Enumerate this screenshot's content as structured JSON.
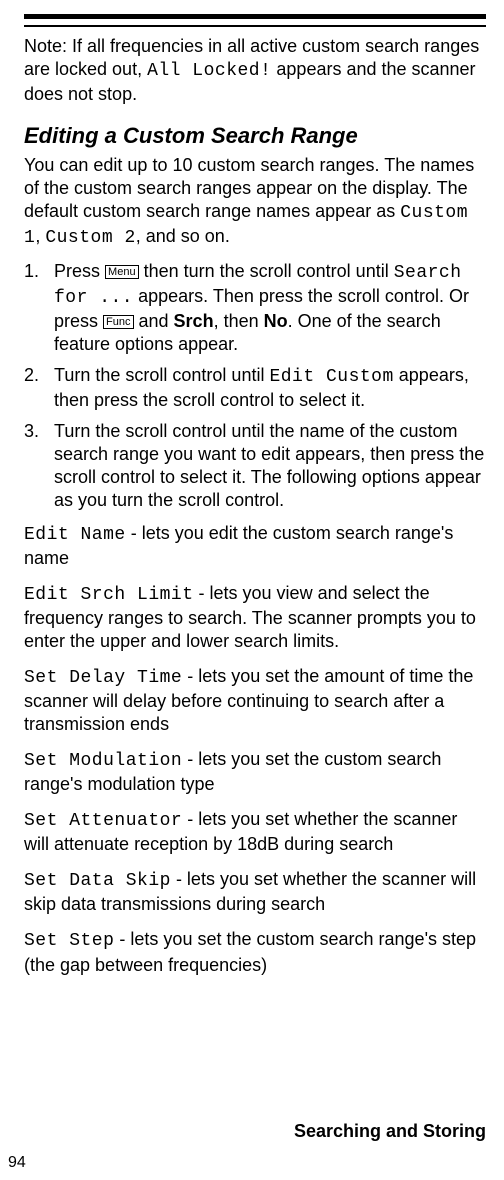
{
  "note": {
    "prefix": "Note: If all frequencies in all active custom search ranges are locked out, ",
    "code": "All Locked!",
    "suffix": " appears and the scanner does not stop."
  },
  "heading": "Editing a Custom Search Range",
  "intro": {
    "a": "You can edit up to 10 custom search ranges. The names of the custom search ranges appear on the display. The default custom search range names appear as ",
    "code1": "Custom 1",
    "b": ", ",
    "code2": "Custom 2",
    "c": ", and so on."
  },
  "steps": {
    "s1": {
      "num": "1.",
      "a": "Press ",
      "key1": "Menu",
      "b": " then turn the scroll control until ",
      "code": "Search for ...",
      "c": " appears. Then press the scroll control. Or press ",
      "key2": "Func",
      "d": " and ",
      "bold1": "Srch",
      "e": ", then ",
      "bold2": "No",
      "f": ". One of the search feature options appear."
    },
    "s2": {
      "num": "2.",
      "a": "Turn the scroll control until ",
      "code": "Edit Custom",
      "b": " appears, then press the scroll control to select it."
    },
    "s3": {
      "num": "3.",
      "a": "Turn the scroll control until the name of the custom search range you want to edit appears, then press the scroll control to select it. The following options appear as you turn the scroll control."
    }
  },
  "options": {
    "o1": {
      "code": "Edit Name",
      "desc": " - lets you edit the custom search range's name"
    },
    "o2": {
      "code": "Edit Srch Limit",
      "desc": " - lets you view and select the frequency ranges to search. The scanner prompts you to enter the upper and lower search limits."
    },
    "o3": {
      "code": "Set Delay Time",
      "desc": " - lets you set the amount of time the scanner will delay before continuing to search after a transmission ends"
    },
    "o4": {
      "code": "Set Modulation",
      "desc": " - lets you set the custom search range's modulation type"
    },
    "o5": {
      "code": "Set Attenuator",
      "desc": " - lets you set whether the scanner will attenuate reception by 18dB during search"
    },
    "o6": {
      "code": "Set Data Skip",
      "desc": " - lets you set whether the scanner will skip data transmissions during search"
    },
    "o7": {
      "code": "Set Step",
      "desc": " - lets you set the custom search range's step (the gap between frequencies)"
    }
  },
  "footer": "Searching and Storing",
  "page": "94"
}
